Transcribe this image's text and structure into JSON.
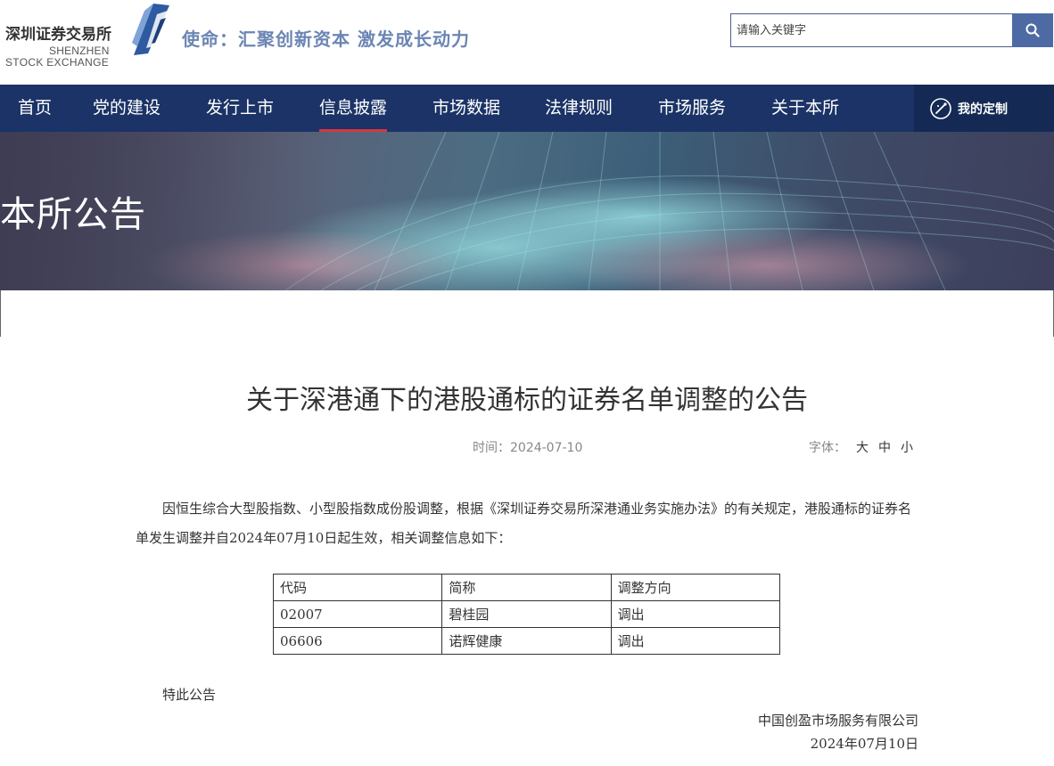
{
  "header": {
    "logo_cn": "深圳证券交易所",
    "logo_en_1": "SHENZHEN",
    "logo_en_2": "STOCK EXCHANGE",
    "slogan": "使命：汇聚创新资本 激发成长动力",
    "search_placeholder": "请输入关键字",
    "search_icon": "search-icon"
  },
  "nav": {
    "items": [
      {
        "label": "首页"
      },
      {
        "label": "党的建设"
      },
      {
        "label": "发行上市"
      },
      {
        "label": "信息披露",
        "active": true
      },
      {
        "label": "市场数据"
      },
      {
        "label": "法律规则"
      },
      {
        "label": "市场服务"
      },
      {
        "label": "关于本所"
      }
    ],
    "custom_label": "我的定制",
    "custom_icon": "customize-icon"
  },
  "banner": {
    "title": "本所公告"
  },
  "article": {
    "title": "关于深港通下的港股通标的证券名单调整的公告",
    "time_label": "时间：2024-07-10",
    "font_label": "字体：",
    "font_sizes": [
      "大",
      "中",
      "小"
    ],
    "paragraph": "因恒生综合大型股指数、小型股指数成份股调整，根据《深圳证券交易所深港通业务实施办法》的有关规定，港股通标的证券名单发生调整并自2024年07月10日起生效，相关调整信息如下：",
    "table": {
      "headers": [
        "代码",
        "简称",
        "调整方向"
      ],
      "rows": [
        [
          "02007",
          "碧桂园",
          "调出"
        ],
        [
          "06606",
          "诺辉健康",
          "调出"
        ]
      ]
    },
    "closing": "特此公告",
    "org": "中国创盈市场服务有限公司",
    "date": "2024年07月10日"
  },
  "colors": {
    "nav_bg": "#1b3366",
    "nav_active_underline": "#d5373f",
    "search_btn": "#4d6aa5",
    "slogan": "#6b85b4"
  }
}
